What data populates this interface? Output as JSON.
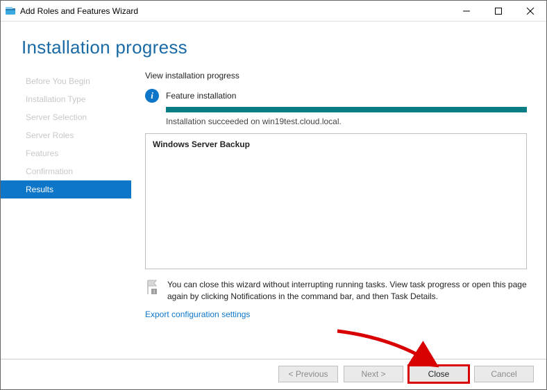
{
  "window": {
    "title": "Add Roles and Features Wizard"
  },
  "header": {
    "title": "Installation progress"
  },
  "sidebar": {
    "items": [
      {
        "label": "Before You Begin",
        "active": false
      },
      {
        "label": "Installation Type",
        "active": false
      },
      {
        "label": "Server Selection",
        "active": false
      },
      {
        "label": "Server Roles",
        "active": false
      },
      {
        "label": "Features",
        "active": false
      },
      {
        "label": "Confirmation",
        "active": false
      },
      {
        "label": "Results",
        "active": true
      }
    ]
  },
  "main": {
    "section_label": "View installation progress",
    "status_heading": "Feature installation",
    "succeeded_text": "Installation succeeded on win19test.cloud.local.",
    "results_item": "Windows Server Backup",
    "note_text": "You can close this wizard without interrupting running tasks. View task progress or open this page again by clicking Notifications in the command bar, and then Task Details.",
    "export_link": "Export configuration settings"
  },
  "footer": {
    "previous": "< Previous",
    "next": "Next >",
    "close": "Close",
    "cancel": "Cancel"
  }
}
